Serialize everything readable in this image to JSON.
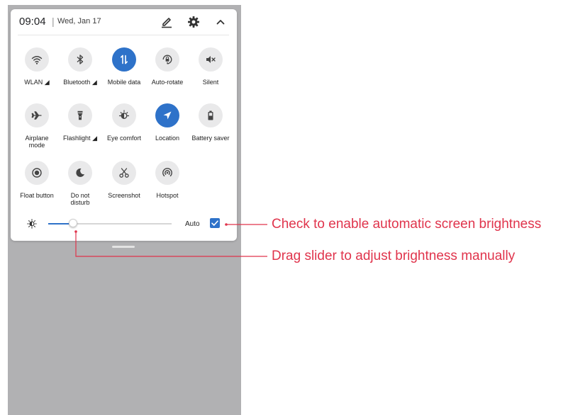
{
  "status": {
    "time": "09:04",
    "date": "Wed, Jan 17"
  },
  "header_icons": {
    "edit": "edit-icon",
    "settings": "gear-icon",
    "collapse": "chevron-up-icon"
  },
  "tiles": [
    {
      "label": "WLAN",
      "icon": "wifi-icon",
      "active": false,
      "has_caret": true
    },
    {
      "label": "Bluetooth",
      "icon": "bluetooth-icon",
      "active": false,
      "has_caret": true
    },
    {
      "label": "Mobile data",
      "icon": "mobile-data-icon",
      "active": true,
      "has_caret": false
    },
    {
      "label": "Auto-rotate",
      "icon": "auto-rotate-icon",
      "active": false,
      "has_caret": false
    },
    {
      "label": "Silent",
      "icon": "silent-icon",
      "active": false,
      "has_caret": false
    },
    {
      "label": "Airplane",
      "label2": "mode",
      "icon": "airplane-icon",
      "active": false,
      "has_caret": false
    },
    {
      "label": "Flashlight",
      "icon": "flashlight-icon",
      "active": false,
      "has_caret": true
    },
    {
      "label": "Eye comfort",
      "icon": "eye-comfort-icon",
      "active": false,
      "has_caret": false
    },
    {
      "label": "Location",
      "icon": "location-icon",
      "active": true,
      "has_caret": false
    },
    {
      "label": "Battery saver",
      "icon": "battery-saver-icon",
      "active": false,
      "has_caret": false
    },
    {
      "label": "Float button",
      "icon": "float-button-icon",
      "active": false,
      "has_caret": false
    },
    {
      "label": "Do not",
      "label2": "disturb",
      "icon": "do-not-disturb-icon",
      "active": false,
      "has_caret": false
    },
    {
      "label": "Screenshot",
      "icon": "screenshot-icon",
      "active": false,
      "has_caret": false
    },
    {
      "label": "Hotspot",
      "icon": "hotspot-icon",
      "active": false,
      "has_caret": false
    }
  ],
  "brightness": {
    "auto_label": "Auto",
    "auto_checked": true,
    "level_fraction": 0.2
  },
  "annotations": {
    "auto_brightness": "Check to enable automatic screen brightness",
    "slider": "Drag slider to adjust brightness manually"
  },
  "colors": {
    "accent": "#2e72c9",
    "annotation": "#e0344c",
    "shade": "#b1b1b3"
  }
}
